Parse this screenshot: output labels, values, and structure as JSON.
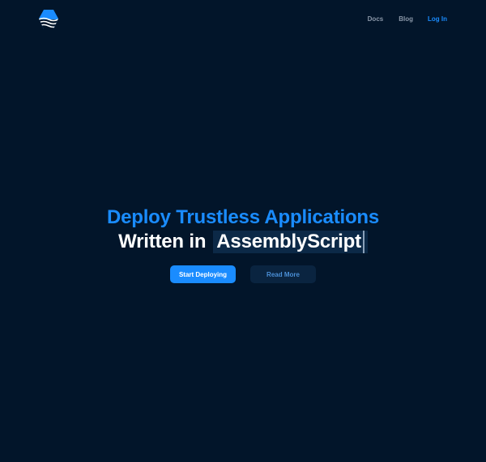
{
  "header": {
    "logo_icon": "hexagon-waves-logo-icon",
    "nav": {
      "docs_label": "Docs",
      "blog_label": "Blog",
      "login_label": "Log In"
    }
  },
  "hero": {
    "headline_line1": "Deploy Trustless Applications",
    "headline_prefix": "Written in",
    "headline_typed": "AssemblyScript"
  },
  "actions": {
    "primary_label": "Start Deploying",
    "secondary_label": "Read More"
  },
  "colors": {
    "background": "#02152a",
    "accent": "#1a8cff",
    "nav_text": "#8a97a8",
    "typed_highlight": "#0c2947",
    "secondary_button": "#0a2440"
  }
}
